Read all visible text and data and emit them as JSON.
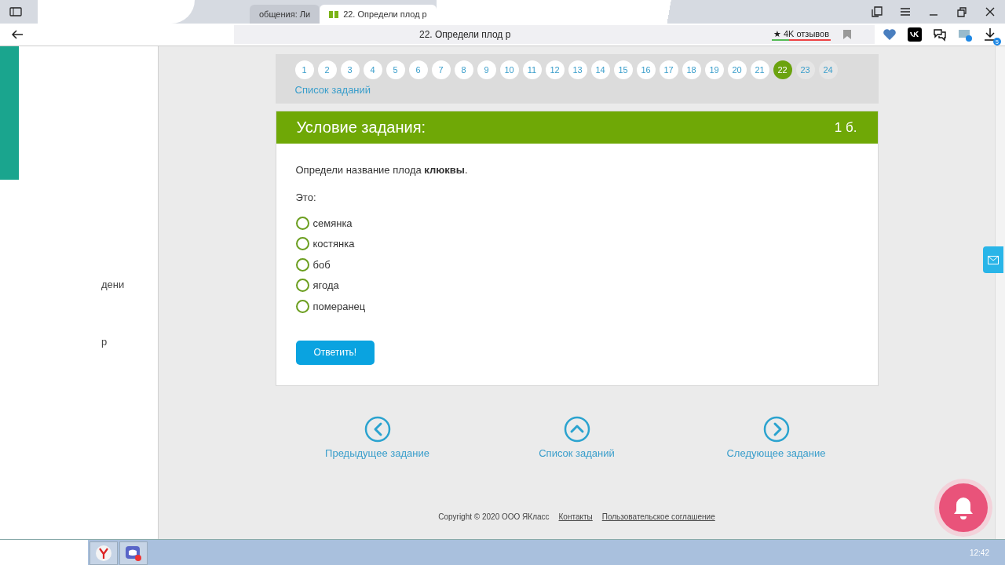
{
  "browser": {
    "tabs": [
      {
        "title": "общения: Ли",
        "selected": false
      },
      {
        "title": "22. Определи плод р",
        "selected": true
      }
    ],
    "address_title": "22. Определи плод р",
    "reviews": "★ 4K отзывов",
    "downloads_badge": "5"
  },
  "sidebar": {
    "fragments": [
      "дени",
      "р"
    ]
  },
  "pagination": {
    "pages": [
      {
        "label": "1",
        "selected": false,
        "visited": true
      },
      {
        "label": "2",
        "selected": false,
        "visited": true
      },
      {
        "label": "3",
        "selected": false,
        "visited": true
      },
      {
        "label": "4",
        "selected": false,
        "visited": true
      },
      {
        "label": "5",
        "selected": false,
        "visited": true
      },
      {
        "label": "6",
        "selected": false,
        "visited": true
      },
      {
        "label": "7",
        "selected": false,
        "visited": true
      },
      {
        "label": "8",
        "selected": false,
        "visited": true
      },
      {
        "label": "9",
        "selected": false,
        "visited": true
      },
      {
        "label": "10",
        "selected": false,
        "visited": true
      },
      {
        "label": "11",
        "selected": false,
        "visited": true
      },
      {
        "label": "12",
        "selected": false,
        "visited": true
      },
      {
        "label": "13",
        "selected": false,
        "visited": true
      },
      {
        "label": "14",
        "selected": false,
        "visited": true
      },
      {
        "label": "15",
        "selected": false,
        "visited": true
      },
      {
        "label": "16",
        "selected": false,
        "visited": true
      },
      {
        "label": "17",
        "selected": false,
        "visited": true
      },
      {
        "label": "18",
        "selected": false,
        "visited": true
      },
      {
        "label": "19",
        "selected": false,
        "visited": true
      },
      {
        "label": "20",
        "selected": false,
        "visited": true
      },
      {
        "label": "21",
        "selected": false,
        "visited": true
      },
      {
        "label": "22",
        "selected": true,
        "visited": true
      },
      {
        "label": "23",
        "selected": false,
        "visited": false
      },
      {
        "label": "24",
        "selected": false,
        "visited": false
      }
    ],
    "list_link": "Список заданий"
  },
  "task": {
    "header": "Условие задания:",
    "points": "1 б.",
    "question": "Определи название плода **клюквы**.",
    "prompt": "Это:",
    "options": [
      {
        "label": "семянка",
        "selected": false
      },
      {
        "label": "костянка",
        "selected": false
      },
      {
        "label": "боб",
        "selected": false
      },
      {
        "label": "ягода",
        "selected": false
      },
      {
        "label": "померанец",
        "selected": false
      }
    ],
    "submit": "Ответить!"
  },
  "nav": [
    {
      "kind": "prev",
      "label": "Предыдущее задание"
    },
    {
      "kind": "up",
      "label": "Список заданий"
    },
    {
      "kind": "next",
      "label": "Следующее задание"
    }
  ],
  "footer": {
    "copyright": "Copyright © 2020 ООО ЯКласс",
    "links": [
      "Контакты",
      "Пользовательское соглашение"
    ]
  },
  "taskbar": {
    "clock": "12:42"
  }
}
